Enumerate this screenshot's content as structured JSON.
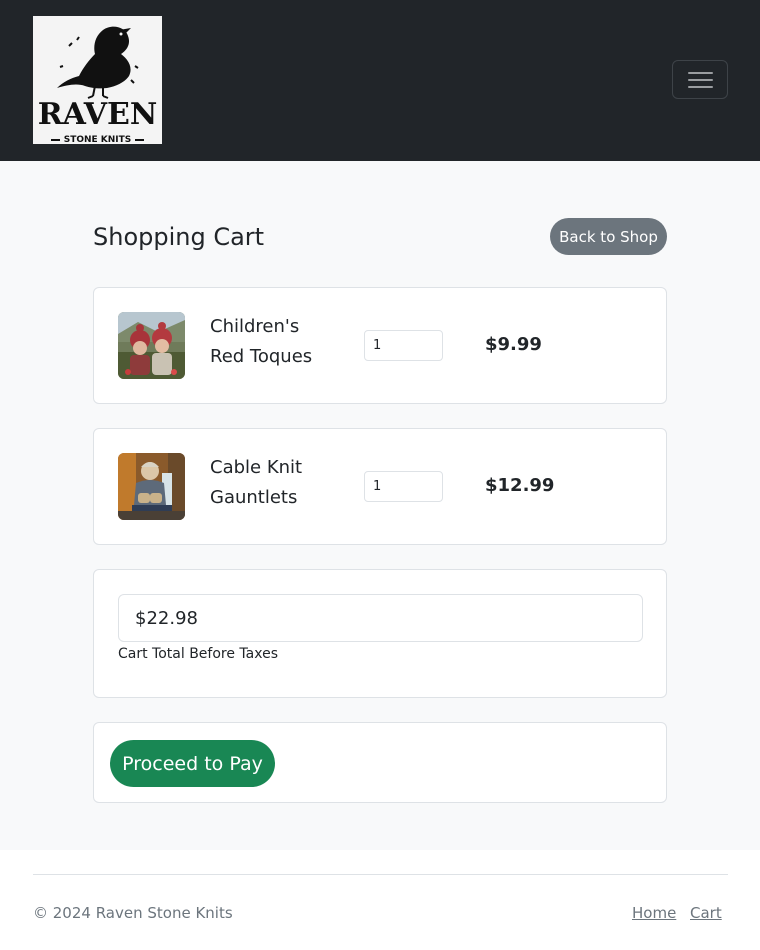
{
  "brand": {
    "name": "RAVEN",
    "tagline": "STONE KNITS",
    "logo_icon": "raven-icon"
  },
  "navbar": {
    "menu_icon": "hamburger-menu-icon"
  },
  "page": {
    "title": "Shopping Cart",
    "back_label": "Back to Shop"
  },
  "cart": {
    "items": [
      {
        "name": "Children's Red Toques",
        "quantity": "1",
        "price": "$9.99",
        "thumbnail": "children-red-toques-photo"
      },
      {
        "name": "Cable Knit Gauntlets",
        "quantity": "1",
        "price": "$12.99",
        "thumbnail": "cable-knit-gauntlets-photo"
      }
    ],
    "total": "$22.98",
    "total_label": "Cart Total Before Taxes",
    "pay_label": "Proceed to Pay"
  },
  "footer": {
    "copyright": "© 2024 Raven Stone Knits",
    "links": [
      "Home",
      "Cart"
    ]
  },
  "colors": {
    "navbar_bg": "#212529",
    "main_bg": "#f8f9fa",
    "secondary_button": "#6c757d",
    "success_button": "#198754"
  }
}
